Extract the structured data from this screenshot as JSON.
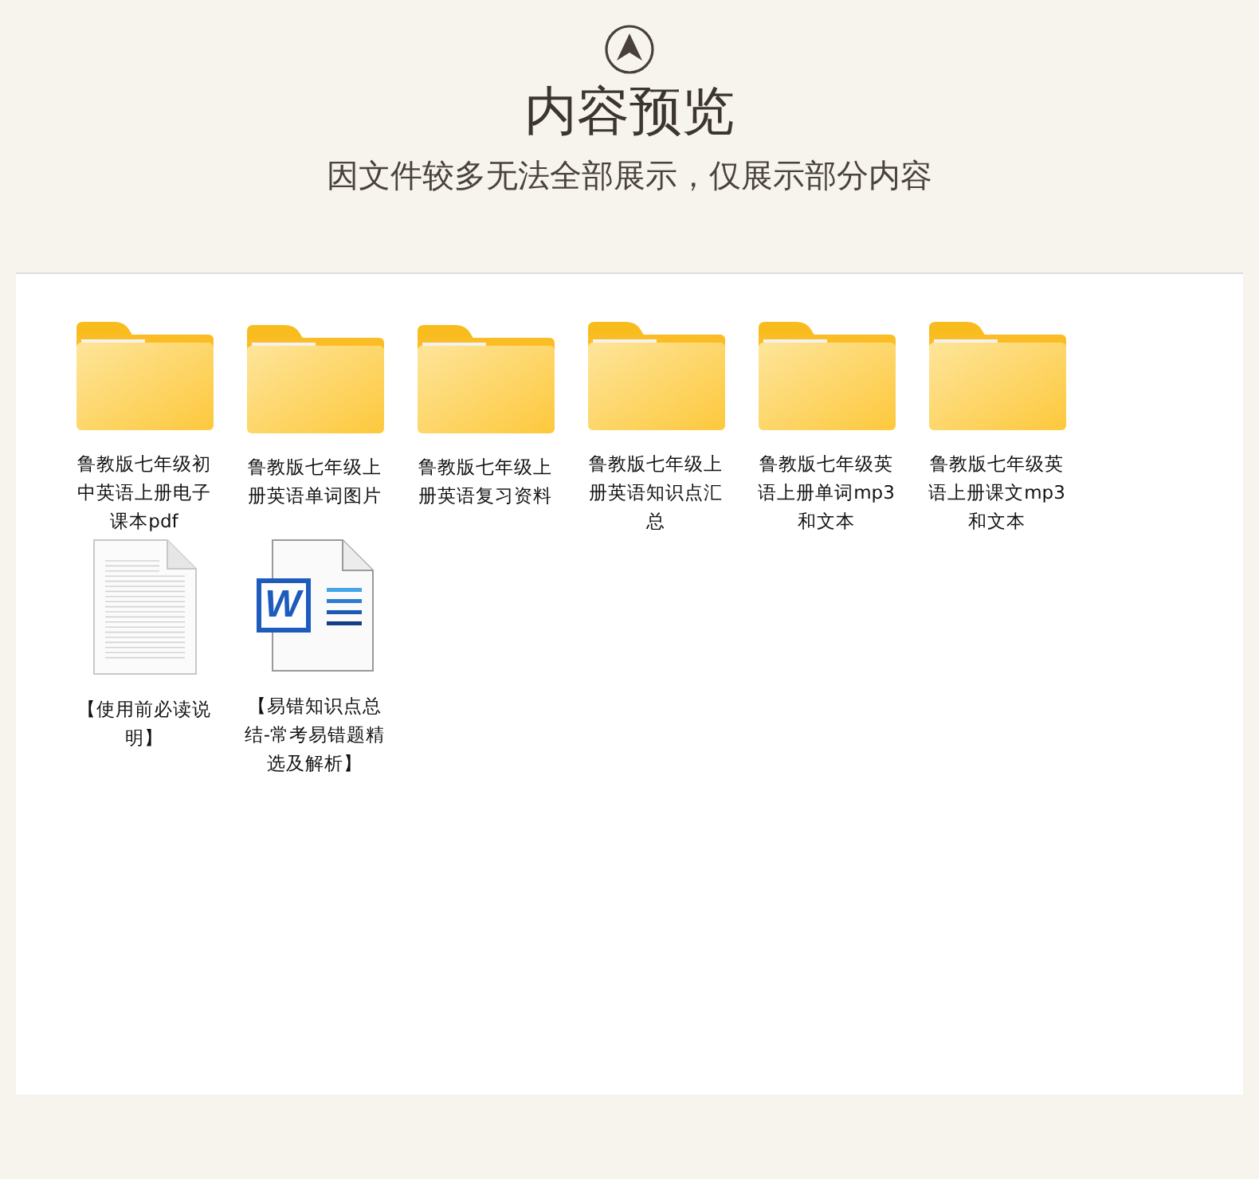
{
  "header": {
    "title": "内容预览",
    "subtitle": "因文件较多无法全部展示，仅展示部分内容"
  },
  "files": [
    {
      "kind": "folder",
      "name": "鲁教版七年级初中英语上册电子课本pdf"
    },
    {
      "kind": "folder",
      "name": "鲁教版七年级上册英语单词图片"
    },
    {
      "kind": "folder",
      "name": "鲁教版七年级上册英语复习资料"
    },
    {
      "kind": "folder",
      "name": "鲁教版七年级上册英语知识点汇总"
    },
    {
      "kind": "folder",
      "name": "鲁教版七年级英语上册单词mp3和文本"
    },
    {
      "kind": "folder",
      "name": "鲁教版七年级英语上册课文mp3和文本"
    },
    {
      "kind": "text",
      "name": "【使用前必读说明】"
    },
    {
      "kind": "word",
      "name": "【易错知识点总结-常考易错题精选及解析】",
      "badge": "W"
    }
  ]
}
